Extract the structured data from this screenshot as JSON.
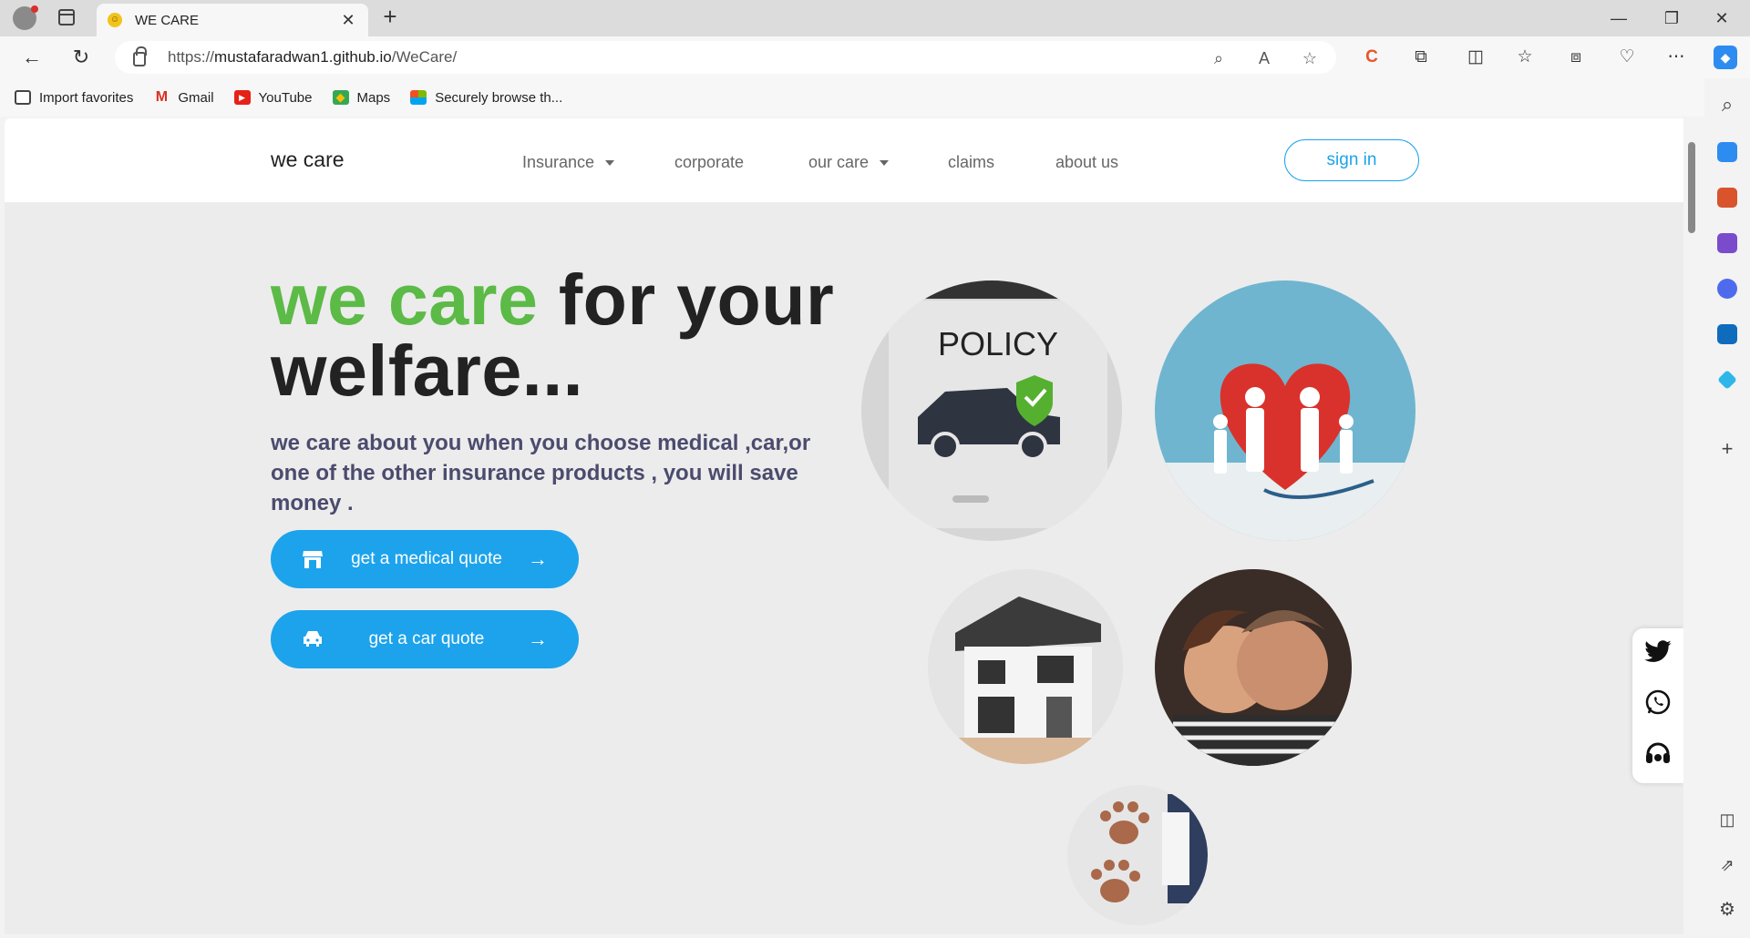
{
  "browser": {
    "tab_title": "WE CARE",
    "url_host": "mustafaradwan1.github.io",
    "url_prefix": "https://",
    "url_path": "/WeCare/",
    "read_aloud": "A",
    "bookmarks": [
      {
        "label": "Import favorites",
        "icon": "import-icon"
      },
      {
        "label": "Gmail",
        "icon": "gmail-icon"
      },
      {
        "label": "YouTube",
        "icon": "youtube-icon"
      },
      {
        "label": "Maps",
        "icon": "maps-icon"
      },
      {
        "label": "Securely browse th...",
        "icon": "windows-icon"
      }
    ]
  },
  "site": {
    "brand": "we care",
    "nav": {
      "insurance": "Insurance",
      "corporate": "corporate",
      "our_care": "our care",
      "claims": "claims",
      "about": "about us",
      "signin": "sign in"
    },
    "hero": {
      "title_green": "we care",
      "title_rest": " for your welfare...",
      "subtitle": "we care about you when you choose medical ,car,or one of the other insurance products , you will save money ."
    },
    "buttons": {
      "medical": "get a medical quote",
      "car": "get a car quote"
    },
    "images": {
      "policy_text": "POLICY"
    }
  },
  "colors": {
    "accent": "#1ca3ec",
    "green": "#5cba47",
    "subtitle": "#4b4b6e"
  }
}
